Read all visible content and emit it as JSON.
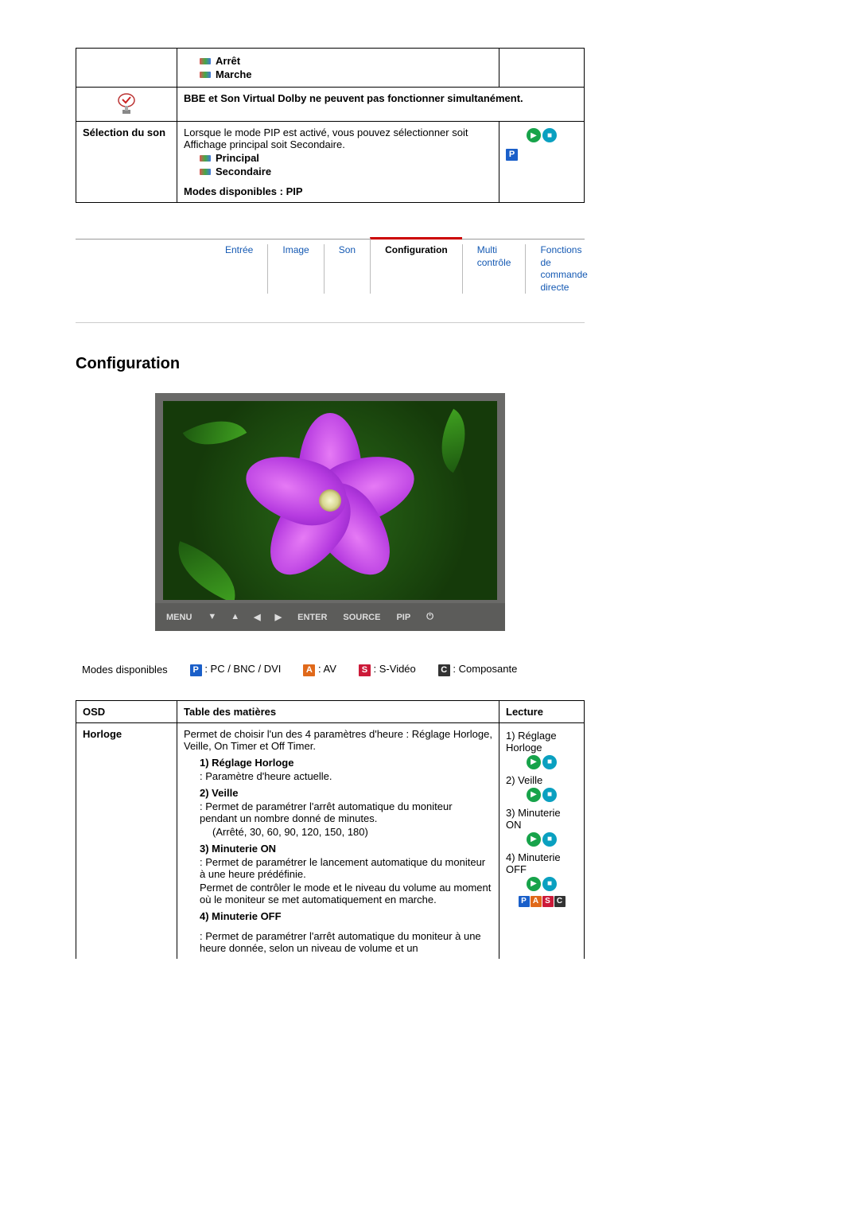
{
  "table1": {
    "row1": {
      "opt1": "Arrêt",
      "opt2": "Marche"
    },
    "note": "BBE et Son Virtual Dolby ne peuvent pas fonctionner simultanément.",
    "row2": {
      "label": "Sélection du son",
      "desc": "Lorsque le mode PIP est activé, vous pouvez sélectionner soit Affichage principal soit Secondaire.",
      "opt1": "Principal",
      "opt2": "Secondaire",
      "modes": "Modes disponibles : PIP",
      "badge": "P"
    }
  },
  "tabs": {
    "t1": "Entrée",
    "t2": "Image",
    "t3": "Son",
    "t4": "Configuration",
    "t5": "Multi contrôle",
    "t6": "Fonctions de commande directe"
  },
  "section_title": "Configuration",
  "monitor_bar": {
    "menu": "MENU",
    "enter": "ENTER",
    "source": "SOURCE",
    "pip": "PIP"
  },
  "modes_line": {
    "label": "Modes disponibles",
    "p": "P",
    "p_txt": ": PC / BNC / DVI",
    "a": "A",
    "a_txt": ": AV",
    "s": "S",
    "s_txt": ": S-Vidéo",
    "c": "C",
    "c_txt": ": Composante"
  },
  "table2": {
    "h1": "OSD",
    "h2": "Table des matières",
    "h3": "Lecture",
    "row1": {
      "label": "Horloge",
      "intro": "Permet de choisir l'un des 4 paramètres d'heure : Réglage Horloge, Veille, On Timer et Off Timer.",
      "s1_t": "1) Réglage Horloge",
      "s1_d": ": Paramètre d'heure actuelle.",
      "s2_t": "2) Veille",
      "s2_d": ": Permet de paramétrer l'arrêt automatique du moniteur pendant un nombre donné de minutes.",
      "s2_opts": "(Arrêté, 30, 60, 90, 120, 150, 180)",
      "s3_t": "3) Minuterie ON",
      "s3_d1": ": Permet de paramétrer le lancement automatique du moniteur à une heure prédéfinie.",
      "s3_d2": "Permet de contrôler le mode et le niveau du volume au moment où le moniteur se met automatiquement en marche.",
      "s4_t": "4) Minuterie OFF",
      "s4_d": ": Permet de paramétrer l'arrêt automatique du moniteur à une heure donnée, selon un niveau de volume et un"
    },
    "lecture": {
      "l1": "1) Réglage Horloge",
      "l2": "2) Veille",
      "l3": "3) Minuterie ON",
      "l4": "4) Minuterie OFF",
      "p": "P",
      "a": "A",
      "s": "S",
      "c": "C"
    }
  }
}
